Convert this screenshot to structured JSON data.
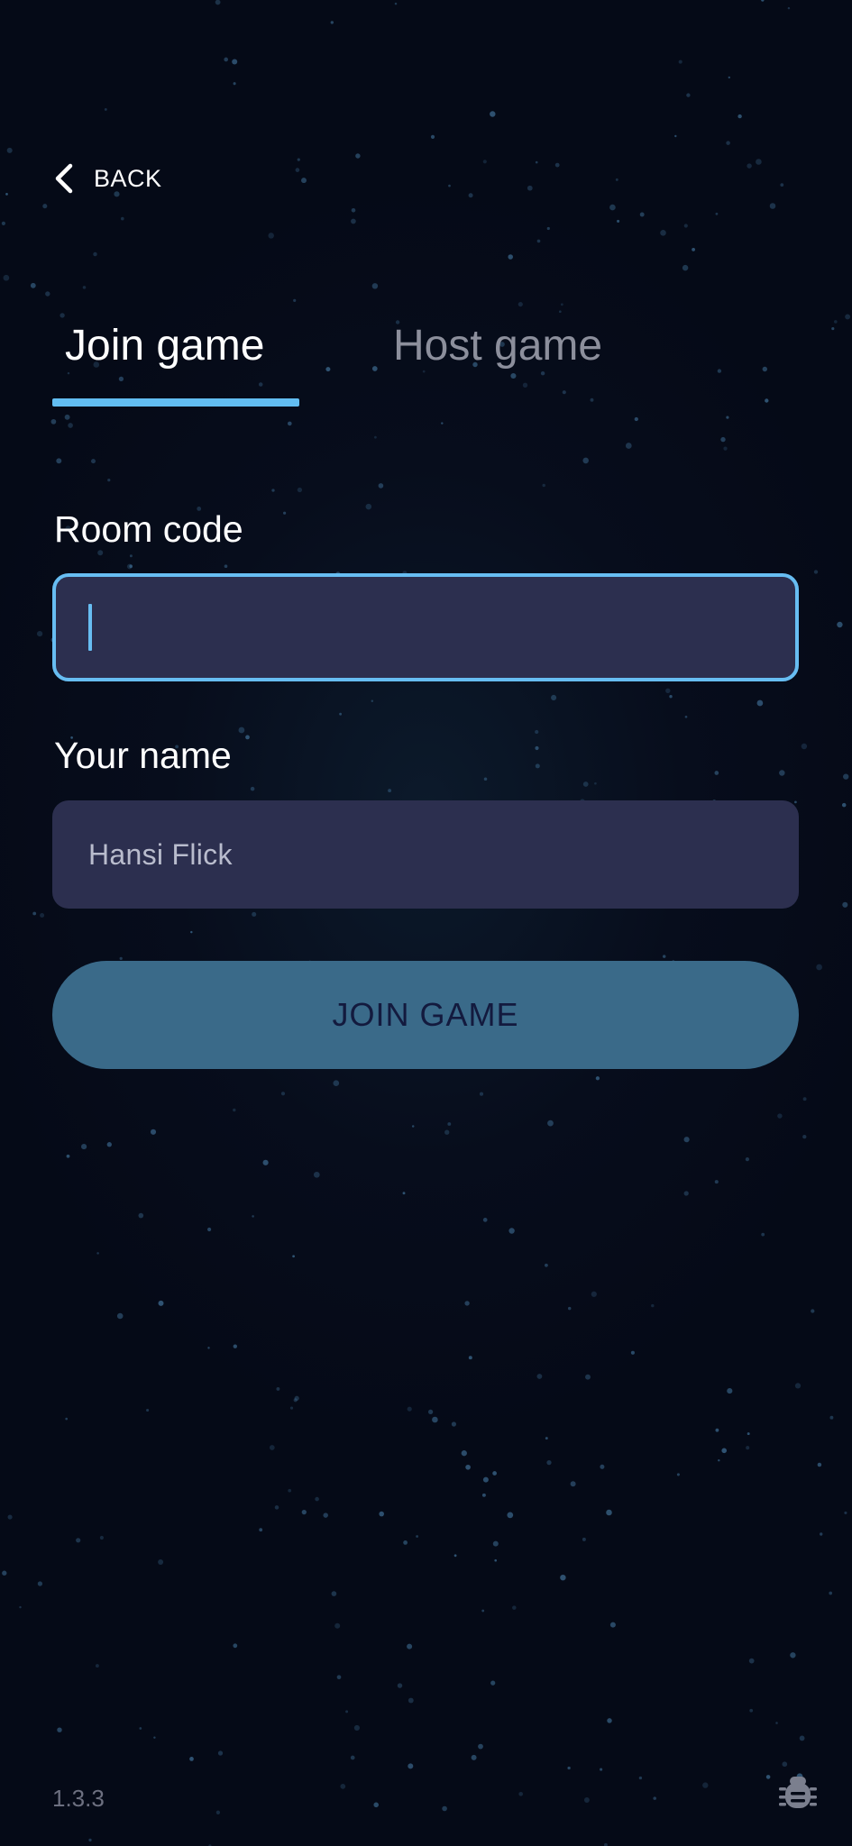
{
  "nav": {
    "back_label": "BACK"
  },
  "tabs": [
    {
      "label": "Join game",
      "active": true
    },
    {
      "label": "Host game",
      "active": false
    }
  ],
  "form": {
    "room_code": {
      "label": "Room code",
      "value": ""
    },
    "your_name": {
      "label": "Your name",
      "value": "Hansi Flick"
    }
  },
  "join_button": {
    "label": "JOIN GAME"
  },
  "footer": {
    "version": "1.3.3",
    "bug_icon": "bug-icon"
  },
  "colors": {
    "background": "#050a17",
    "accent": "#62bdf1",
    "field_bg": "#2c2f4f",
    "button_bg": "#3a6a89",
    "button_text": "#131a3e",
    "inactive_tab": "#8c8f9c"
  }
}
